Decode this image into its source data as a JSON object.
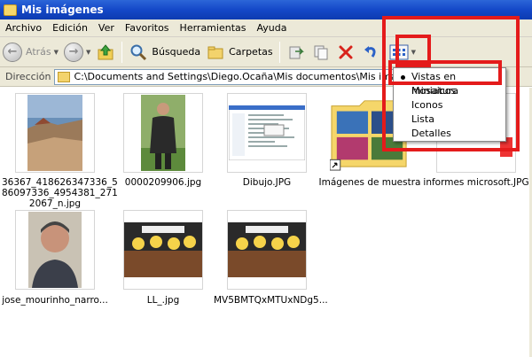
{
  "window": {
    "title": "Mis imágenes"
  },
  "menu": [
    "Archivo",
    "Edición",
    "Ver",
    "Favoritos",
    "Herramientas",
    "Ayuda"
  ],
  "toolbar": {
    "back_label": "Atrás",
    "search_label": "Búsqueda",
    "folders_label": "Carpetas"
  },
  "address": {
    "label": "Dirección",
    "path": "C:\\Documents and Settings\\Diego.Ocaña\\Mis documentos\\Mis imágenes"
  },
  "view_menu": {
    "items": [
      "Vistas en miniatura",
      "Mosaicos",
      "Iconos",
      "Lista",
      "Detalles"
    ],
    "selected": "Vistas en miniatura"
  },
  "files": [
    {
      "name": "36367_418626347336_586097336_4954381_2712067_n.jpg",
      "lines": [
        "36367_418626347336_5",
        "86097336_4954381_271",
        "2067_n.jpg"
      ]
    },
    {
      "name": "0000209906.jpg",
      "lines": [
        "0000209906.jpg"
      ]
    },
    {
      "name": "Dibujo.JPG",
      "lines": [
        "Dibujo.JPG"
      ]
    },
    {
      "name": "Imágenes de muestra",
      "lines": [
        "Imágenes de muestra"
      ]
    },
    {
      "name": "informes microsoft.JPG",
      "lines": [
        "informes microsoft.JPG"
      ]
    },
    {
      "name": "jose_mourinho_narro...",
      "lines": [
        "jose_mourinho_narro..."
      ]
    },
    {
      "name": "LL_.jpg",
      "lines": [
        "LL_.jpg"
      ]
    },
    {
      "name": "MV5BMTQxMTUxNDg5...",
      "lines": [
        "MV5BMTQxMTUxNDg5..."
      ]
    }
  ],
  "colors": {
    "title_bar": "#1448c8",
    "chrome": "#ece9d8",
    "highlight_box": "#e41b1b"
  }
}
